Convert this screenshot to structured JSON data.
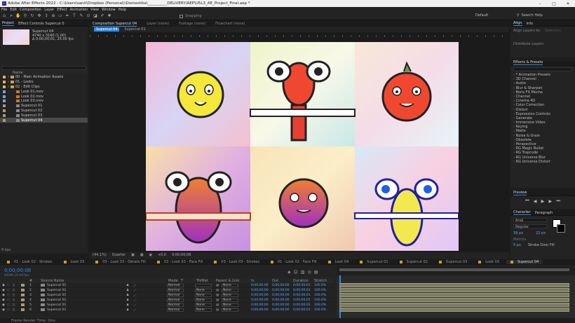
{
  "window": {
    "title": "Adobe After Effects 2022 - C:\\Users\\santi\\Dropbox (Personal)\\Domestika\\__________DELIVERY\\AEP\\U5L3_AE_Project_Final.aep *"
  },
  "menu": [
    "File",
    "Edit",
    "Composition",
    "Layer",
    "Effect",
    "Animation",
    "View",
    "Window",
    "Help"
  ],
  "toolbar": {
    "snapping": "Snapping",
    "workspace": "Default",
    "search": "Search Help"
  },
  "project": {
    "tabs": [
      "Project",
      "Effect Controls Supercut 0"
    ],
    "selected_name": "Supercut 04",
    "selected_size": "4740 x 3160 (1.00)",
    "selected_duration": "Δ 0;00;00;01, 25.00 fps",
    "column_name": "Name",
    "items": [
      {
        "label": "00 - Main Animation Assets",
        "type": "folder",
        "color": "#d9b35b"
      },
      {
        "label": "01 - Looks",
        "type": "folder",
        "color": "#d9b35b"
      },
      {
        "label": "02 - Edit Clips",
        "type": "folder",
        "color": "#d9b35b"
      },
      {
        "label": "Look 01.mov",
        "type": "footage",
        "color": "#7aa3d9"
      },
      {
        "label": "Look 02.mov",
        "type": "footage",
        "color": "#7aa3d9"
      },
      {
        "label": "Look 03.mov",
        "type": "footage",
        "color": "#7aa3d9"
      },
      {
        "label": "Supercut 01",
        "type": "comp",
        "color": "#aa9a7a"
      },
      {
        "label": "Supercut 02",
        "type": "comp",
        "color": "#aa9a7a"
      },
      {
        "label": "Supercut 03",
        "type": "comp",
        "color": "#aa9a7a"
      },
      {
        "label": "Supercut 04",
        "type": "comp",
        "color": "#aa9a7a",
        "selected": true
      }
    ],
    "bpc": "8 bpc"
  },
  "composition": {
    "tabs": [
      "Composition Supercut 04",
      "Layer (none)",
      "Footage (none)",
      "Flowchart (none)"
    ],
    "subtabs": [
      "Supercut 04",
      "Supercut 01"
    ],
    "zoom": "(44.1%)",
    "quality": "Quarter",
    "time": "0;00;00;08",
    "exposure": "+0.0"
  },
  "align": {
    "tabs": [
      "Align",
      "Info"
    ],
    "align_layers_to": "Align Layers to:",
    "target": "Selection",
    "distribute": "Distribute Layers:"
  },
  "effects": {
    "title": "Effects & Presets",
    "search": "",
    "items": [
      "* Animation Presets",
      "3D Channel",
      "Audio",
      "Blur & Sharpen",
      "Boris FX Mocha",
      "Channel",
      "Cinema 4D",
      "Color Correction",
      "Distort",
      "Expression Controls",
      "Generate",
      "Immersive Video",
      "Keying",
      "Matte",
      "Noise & Grain",
      "Obsolete",
      "Perspective",
      "RG Magic Bullet",
      "RG Trapcode",
      "RG Universe Blur",
      "RG Universe Distort"
    ]
  },
  "preview": {
    "title": "Preview"
  },
  "character": {
    "tabs": [
      "Character",
      "Paragraph"
    ],
    "font": "Arial",
    "style": "Regular",
    "size": "39 px",
    "leading": "22 px",
    "tracking": "Metrics",
    "stroke_width": "5 px",
    "stroke_mode": "Stroke Over Fill"
  },
  "timeline": {
    "tabs": [
      "01 - Look 02 - Strokes",
      "Look 03",
      "03 - Look 03 - Details Fill",
      "03 - Look 03 - Face Fill",
      "03 - Look 03 - Strokes",
      "01 - Look 02 - Face Fill",
      "Look 04",
      "Supercut 01",
      "Supercut 02",
      "Supercut 03",
      "Look 03",
      "Supercut 04"
    ],
    "time": "0;00;00;08",
    "frames": "00008 (25.00 fps)",
    "columns": [
      "#",
      "Source Name",
      "Mode",
      "T",
      "TrkMat",
      "Parent & Link",
      "In",
      "Out",
      "Duration",
      "Stretch"
    ],
    "rows": [
      {
        "num": "1",
        "name": "Supercut 01",
        "mode": "Normal",
        "trkmat": "",
        "parent": "None",
        "in": "0;00;00;00",
        "out": "0;00;00;00",
        "dur": "0;00;00;01",
        "stretch": "100.0%"
      },
      {
        "num": "2",
        "name": "Supercut 01",
        "mode": "Normal",
        "trkmat": "None",
        "parent": "None",
        "in": "0;00;00;00",
        "out": "0;00;00;00",
        "dur": "0;00;00;01",
        "stretch": "100.0%"
      },
      {
        "num": "3",
        "name": "Supercut 01",
        "mode": "Normal",
        "trkmat": "None",
        "parent": "None",
        "in": "0;00;00;00",
        "out": "0;00;00;00",
        "dur": "0;00;00;01",
        "stretch": "100.0%"
      },
      {
        "num": "4",
        "name": "Supercut 01",
        "mode": "Normal",
        "trkmat": "None",
        "parent": "None",
        "in": "0;00;00;00",
        "out": "0;00;00;00",
        "dur": "0;00;00;01",
        "stretch": "100.0%"
      },
      {
        "num": "5",
        "name": "Supercut 01",
        "mode": "Normal",
        "trkmat": "None",
        "parent": "None",
        "in": "0;00;00;00",
        "out": "0;00;00;00",
        "dur": "0;00;00;01",
        "stretch": "100.0%"
      },
      {
        "num": "6",
        "name": "Supercut 01",
        "mode": "Normal",
        "trkmat": "None",
        "parent": "None",
        "in": "0;00;00;00",
        "out": "0;00;00;00",
        "dur": "0;00;00;01",
        "stretch": "100.0%"
      }
    ]
  },
  "status": {
    "render": "Frame Render Time: 2ms"
  }
}
